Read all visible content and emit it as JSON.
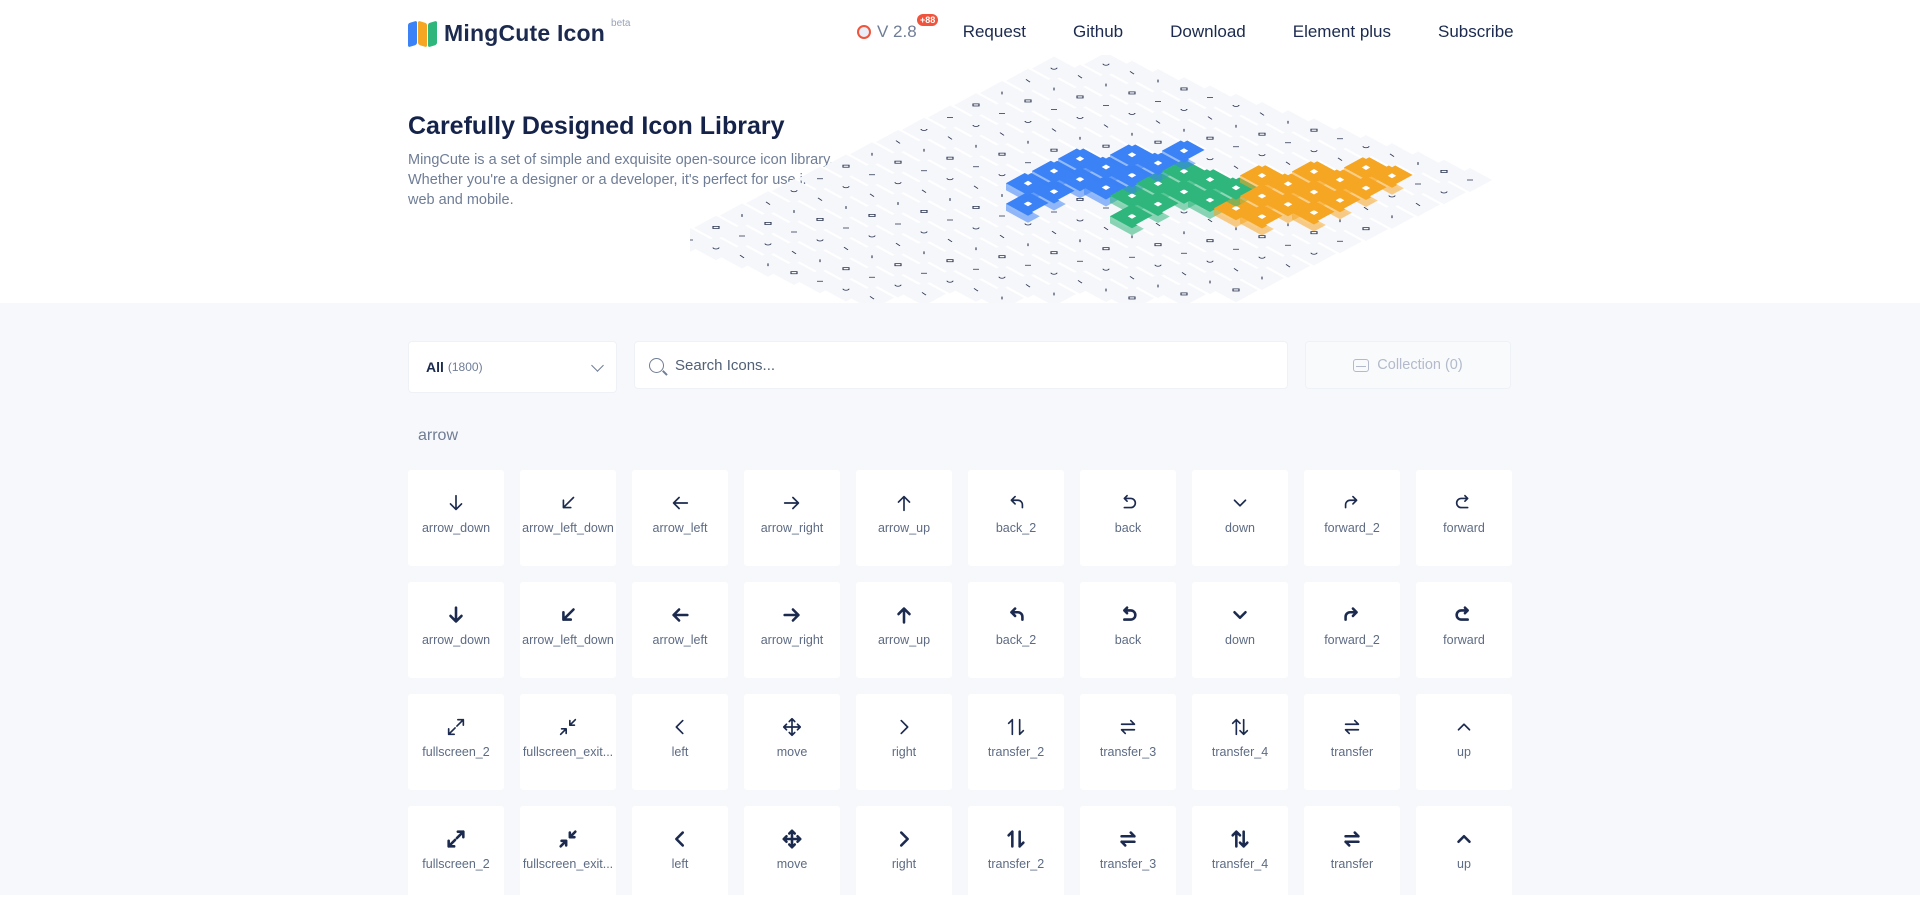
{
  "header": {
    "logo_text": "MingCute Icon",
    "logo_badge": "beta",
    "version": "V 2.8",
    "version_badge": "+88",
    "nav": [
      "Request",
      "Github",
      "Download",
      "Element plus",
      "Subscribe"
    ]
  },
  "hero": {
    "title": "Carefully Designed Icon Library",
    "description": "MingCute is a set of simple and exquisite open-source icon library. Whether you're a designer or a developer, it's perfect for use in web and mobile."
  },
  "toolbar": {
    "filter_label": "All",
    "filter_count": "(1800)",
    "search_placeholder": "Search Icons...",
    "collection_label": "Collection (0)"
  },
  "section": {
    "title": "arrow"
  },
  "icons": [
    {
      "label": "arrow_down",
      "icon": "arrow-down-icon",
      "glyph": "arrow_down",
      "bold": false
    },
    {
      "label": "arrow_left_down",
      "icon": "arrow-left-down-icon",
      "glyph": "arrow_left_down",
      "bold": false
    },
    {
      "label": "arrow_left",
      "icon": "arrow-left-icon",
      "glyph": "arrow_left",
      "bold": false
    },
    {
      "label": "arrow_right",
      "icon": "arrow-right-icon",
      "glyph": "arrow_right",
      "bold": false
    },
    {
      "label": "arrow_up",
      "icon": "arrow-up-icon",
      "glyph": "arrow_up",
      "bold": false
    },
    {
      "label": "back_2",
      "icon": "back-2-icon",
      "glyph": "back_2",
      "bold": false
    },
    {
      "label": "back",
      "icon": "back-icon",
      "glyph": "back",
      "bold": false
    },
    {
      "label": "down",
      "icon": "down-icon",
      "glyph": "down",
      "bold": false
    },
    {
      "label": "forward_2",
      "icon": "forward-2-icon",
      "glyph": "forward_2",
      "bold": false
    },
    {
      "label": "forward",
      "icon": "forward-icon",
      "glyph": "forward",
      "bold": false
    },
    {
      "label": "arrow_down",
      "icon": "arrow-down-icon",
      "glyph": "arrow_down",
      "bold": true
    },
    {
      "label": "arrow_left_down",
      "icon": "arrow-left-down-icon",
      "glyph": "arrow_left_down",
      "bold": true
    },
    {
      "label": "arrow_left",
      "icon": "arrow-left-icon",
      "glyph": "arrow_left",
      "bold": true
    },
    {
      "label": "arrow_right",
      "icon": "arrow-right-icon",
      "glyph": "arrow_right",
      "bold": true
    },
    {
      "label": "arrow_up",
      "icon": "arrow-up-icon",
      "glyph": "arrow_up",
      "bold": true
    },
    {
      "label": "back_2",
      "icon": "back-2-icon",
      "glyph": "back_2",
      "bold": true
    },
    {
      "label": "back",
      "icon": "back-icon",
      "glyph": "back",
      "bold": true
    },
    {
      "label": "down",
      "icon": "down-icon",
      "glyph": "down",
      "bold": true
    },
    {
      "label": "forward_2",
      "icon": "forward-2-icon",
      "glyph": "forward_2",
      "bold": true
    },
    {
      "label": "forward",
      "icon": "forward-icon",
      "glyph": "forward",
      "bold": true
    },
    {
      "label": "fullscreen_2",
      "icon": "fullscreen-2-icon",
      "glyph": "fullscreen_2",
      "bold": false
    },
    {
      "label": "fullscreen_exit...",
      "icon": "fullscreen-exit-icon",
      "glyph": "fullscreen_exit",
      "bold": false
    },
    {
      "label": "left",
      "icon": "left-icon",
      "glyph": "left",
      "bold": false
    },
    {
      "label": "move",
      "icon": "move-icon",
      "glyph": "move",
      "bold": false
    },
    {
      "label": "right",
      "icon": "right-icon",
      "glyph": "right",
      "bold": false
    },
    {
      "label": "transfer_2",
      "icon": "transfer-2-icon",
      "glyph": "transfer_2",
      "bold": false
    },
    {
      "label": "transfer_3",
      "icon": "transfer-3-icon",
      "glyph": "transfer_3",
      "bold": false
    },
    {
      "label": "transfer_4",
      "icon": "transfer-4-icon",
      "glyph": "transfer_4",
      "bold": false
    },
    {
      "label": "transfer",
      "icon": "transfer-icon",
      "glyph": "transfer",
      "bold": false
    },
    {
      "label": "up",
      "icon": "up-icon",
      "glyph": "up",
      "bold": false
    },
    {
      "label": "fullscreen_2",
      "icon": "fullscreen-2-icon",
      "glyph": "fullscreen_2",
      "bold": true
    },
    {
      "label": "fullscreen_exit...",
      "icon": "fullscreen-exit-icon",
      "glyph": "fullscreen_exit",
      "bold": true
    },
    {
      "label": "left",
      "icon": "left-icon",
      "glyph": "left",
      "bold": true
    },
    {
      "label": "move",
      "icon": "move-icon",
      "glyph": "move",
      "bold": true
    },
    {
      "label": "right",
      "icon": "right-icon",
      "glyph": "right",
      "bold": true
    },
    {
      "label": "transfer_2",
      "icon": "transfer-2-icon",
      "glyph": "transfer_2",
      "bold": true
    },
    {
      "label": "transfer_3",
      "icon": "transfer-3-icon",
      "glyph": "transfer_3",
      "bold": true
    },
    {
      "label": "transfer_4",
      "icon": "transfer-4-icon",
      "glyph": "transfer_4",
      "bold": true
    },
    {
      "label": "transfer",
      "icon": "transfer-icon",
      "glyph": "transfer",
      "bold": true
    },
    {
      "label": "up",
      "icon": "up-icon",
      "glyph": "up",
      "bold": true
    }
  ],
  "colors": {
    "text_dark": "#1b2a4e",
    "text_muted": "#6f7d96",
    "accent_orange": "#f5a623",
    "accent_green": "#2fb67c",
    "accent_blue": "#3b82f6",
    "badge_red": "#f0543c",
    "content_bg": "#f7f8fb"
  }
}
